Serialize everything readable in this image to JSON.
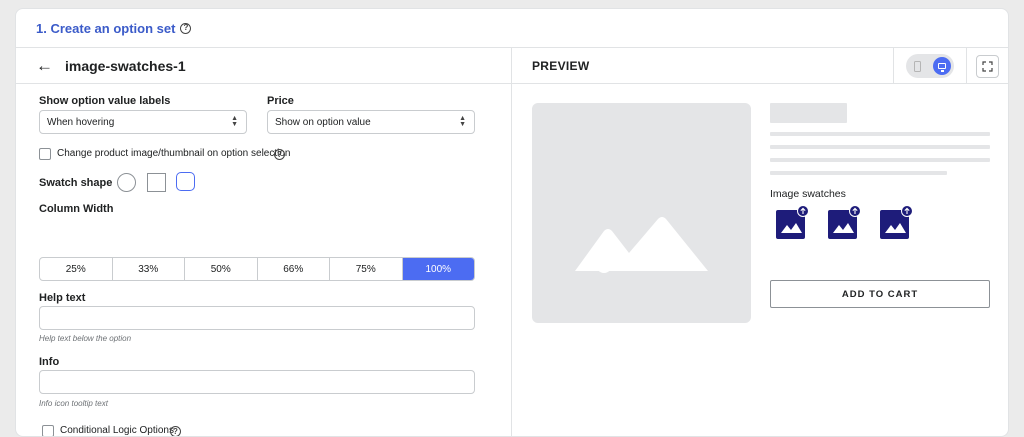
{
  "header": {
    "title": "1. Create an option set",
    "help_icon": "help-circle-icon"
  },
  "left": {
    "back_icon": "arrow-left-icon",
    "option_set_name": "image-swatches-1",
    "show_labels": {
      "label": "Show option value labels",
      "value": "When hovering"
    },
    "price": {
      "label": "Price",
      "value": "Show on option value"
    },
    "change_image": {
      "label": "Change product image/thumbnail on option selection",
      "checked": false
    },
    "swatch_shape": {
      "label": "Swatch shape",
      "options": [
        "circle",
        "square",
        "rounded"
      ],
      "selected": "rounded"
    },
    "column_width": {
      "label": "Column Width",
      "options": [
        "25%",
        "33%",
        "50%",
        "66%",
        "75%",
        "100%"
      ],
      "selected": "100%"
    },
    "help_text": {
      "label": "Help text",
      "value": "",
      "hint": "Help text below the option"
    },
    "info": {
      "label": "Info",
      "value": "",
      "hint": "Info icon tooltip text"
    },
    "conditional_logic": {
      "label": "Conditional Logic Options",
      "checked": false
    }
  },
  "preview": {
    "label": "PREVIEW",
    "device_toggle": {
      "options": [
        "tablet",
        "desktop"
      ],
      "selected": "desktop"
    },
    "fullscreen_icon": "expand-icon",
    "swatches_label": "Image swatches",
    "swatch_count": 3,
    "add_to_cart": "ADD TO CART",
    "colors": {
      "swatch": "#1e1c7a",
      "accent": "#4c6cf2"
    }
  }
}
